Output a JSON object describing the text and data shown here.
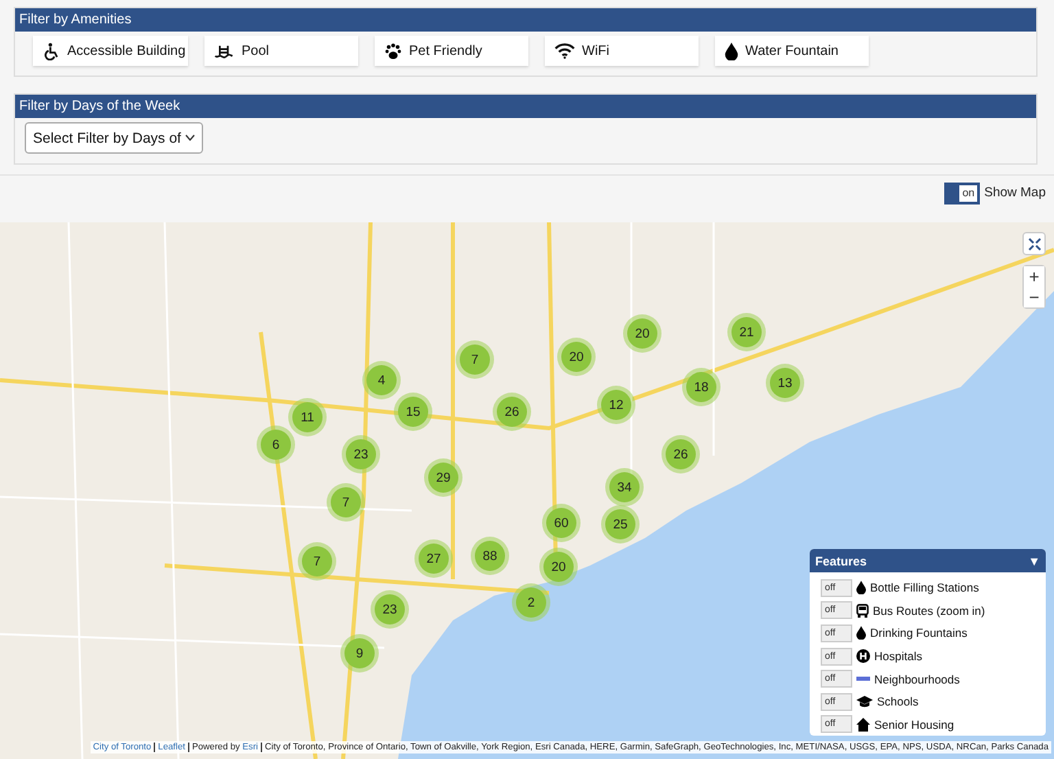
{
  "amenities": {
    "title": "Filter by Amenities",
    "buttons": [
      {
        "label": "Accessible Building",
        "kind": "wheelchair"
      },
      {
        "label": "Pool",
        "kind": "pool"
      },
      {
        "label": "Pet Friendly",
        "kind": "paw"
      },
      {
        "label": "WiFi",
        "kind": "wifi"
      },
      {
        "label": "Water Fountain",
        "kind": "drop"
      }
    ]
  },
  "days": {
    "title": "Filter by Days of the Week",
    "select": "Select Filter by Days of"
  },
  "show_map": {
    "toggle": "on",
    "on": true,
    "label": "Show Map"
  },
  "map": {
    "clusters": [
      {
        "count": "20"
      },
      {
        "count": "21"
      },
      {
        "count": "7"
      },
      {
        "count": "20"
      },
      {
        "count": "4"
      },
      {
        "count": "11"
      },
      {
        "count": "15"
      },
      {
        "count": "26"
      },
      {
        "count": "12"
      },
      {
        "count": "18"
      },
      {
        "count": "13"
      },
      {
        "count": "6"
      },
      {
        "count": "23"
      },
      {
        "count": "26"
      },
      {
        "count": "29"
      },
      {
        "count": "34"
      },
      {
        "count": "7"
      },
      {
        "count": "60"
      },
      {
        "count": "25"
      },
      {
        "count": "27"
      },
      {
        "count": "88"
      },
      {
        "count": "7"
      },
      {
        "count": "20"
      },
      {
        "count": "2"
      },
      {
        "count": "23"
      },
      {
        "count": "9"
      }
    ],
    "zoom_in": "+",
    "zoom_out": "−",
    "features": {
      "title": "Features",
      "caret": "▼",
      "items": [
        {
          "label": "Bottle Filling Stations",
          "kind": "drop",
          "toggle": "off",
          "on": false
        },
        {
          "label": "Bus Routes (zoom in)",
          "kind": "bus",
          "toggle": "off",
          "on": false
        },
        {
          "label": "Drinking Fountains",
          "kind": "drop",
          "toggle": "off",
          "on": false
        },
        {
          "label": "Hospitals",
          "kind": "hospital",
          "toggle": "off",
          "on": false
        },
        {
          "label": "Neighbourhoods",
          "kind": "line",
          "toggle": "off",
          "on": false
        },
        {
          "label": "Schools",
          "kind": "cap",
          "toggle": "off",
          "on": false
        },
        {
          "label": "Senior Housing",
          "kind": "house",
          "toggle": "off",
          "on": false
        }
      ]
    },
    "attribution": {
      "links": [
        "City of Toronto",
        "Leaflet"
      ],
      "powered": "Powered by",
      "esri": "Esri",
      "text": "City of Toronto, Province of Ontario, Town of Oakville, York Region, Esri Canada, HERE, Garmin, SafeGraph, GeoTechnologies, Inc, METI/NASA, USGS, EPA, NPS, USDA, NRCan, Parks Canada"
    }
  }
}
